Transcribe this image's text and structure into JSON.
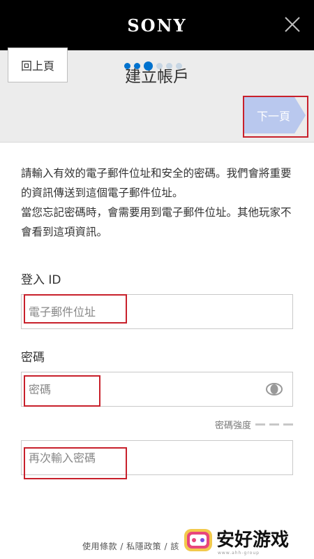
{
  "app": {
    "brand": "SONY"
  },
  "header": {
    "title": "建立帳戶",
    "back_label": "回上頁",
    "next_label": "下一頁",
    "steps_total": 6,
    "current_step": 3
  },
  "intro": {
    "line1": "請輸入有效的電子郵件位址和安全的密碼。我們會將重要的資訊傳送到這個電子郵件位址。",
    "line2": "當您忘記密碼時，會需要用到電子郵件位址。其他玩家不會看到這項資訊。"
  },
  "form": {
    "login_label": "登入 ID",
    "email_placeholder": "電子郵件位址",
    "password_label": "密碼",
    "password_placeholder": "密碼",
    "strength_label": "密碼強度",
    "confirm_placeholder": "再次輸入密碼"
  },
  "footer": {
    "links": "使用條款 / 私隱政策 / 該"
  },
  "watermark": {
    "text": "安好游戏",
    "sub": "www.ahh-group"
  },
  "colors": {
    "accent": "#0072ce",
    "highlight": "#c8202b",
    "next_button": "#b9c8ee",
    "topbar": "#000000"
  }
}
